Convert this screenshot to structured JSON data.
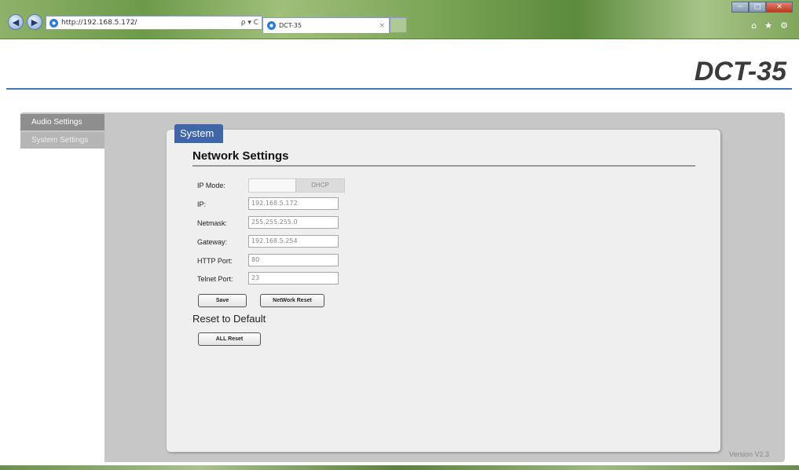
{
  "browser": {
    "address": "http://192.168.5.172/",
    "address_tools": "ρ ▾ C",
    "tab_title": "DCT-35",
    "tab_close": "×",
    "window_controls": [
      "─",
      "□",
      "✕"
    ],
    "toolbar_icons": [
      "⌂",
      "★",
      "⚙"
    ]
  },
  "header": {
    "product": "DCT-35"
  },
  "sidebar": {
    "items": [
      {
        "label": "Audio Settings"
      },
      {
        "label": "System Settings"
      }
    ]
  },
  "panel": {
    "tab": "System",
    "section_title": "Network Settings",
    "fields": {
      "ip_mode_label": "IP Mode:",
      "ip_mode_value": "DHCP",
      "ip_label": "IP:",
      "ip_value": "192.168.5.172",
      "netmask_label": "Netmask:",
      "netmask_value": "255.255.255.0",
      "gateway_label": "Gateway:",
      "gateway_value": "192.168.5.254",
      "http_port_label": "HTTP Port:",
      "http_port_value": "80",
      "telnet_port_label": "Telnet Port:",
      "telnet_port_value": "23"
    },
    "buttons": {
      "save": "Save",
      "network_reset": "NetWork Reset",
      "all_reset": "ALL Reset"
    },
    "reset_title": "Reset to Default"
  },
  "footer": {
    "version": "Version V2.3"
  },
  "colors": {
    "accent": "#3f66a5",
    "header_rule": "#4b77b8",
    "frame": "#c7c7c7"
  }
}
